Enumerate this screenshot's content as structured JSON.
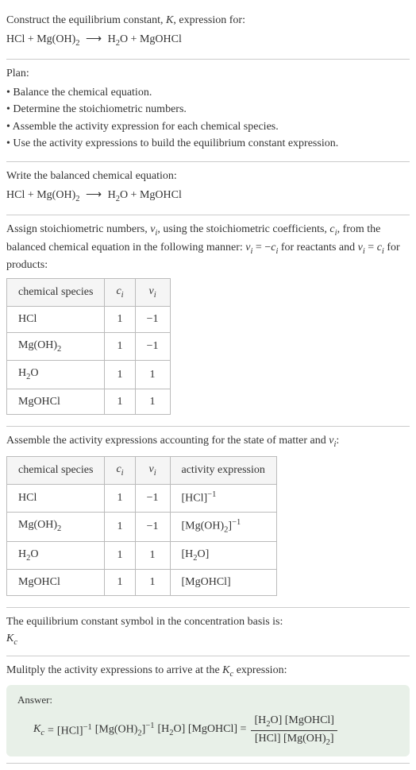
{
  "header": {
    "title_prefix": "Construct the equilibrium constant, ",
    "title_k": "K",
    "title_suffix": ", expression for:",
    "equation_left": "HCl + Mg(OH)",
    "equation_sub1": "2",
    "equation_arrow": "⟶",
    "equation_right1": "H",
    "equation_sub2": "2",
    "equation_right2": "O + MgOHCl"
  },
  "plan": {
    "title": "Plan:",
    "items": [
      "• Balance the chemical equation.",
      "• Determine the stoichiometric numbers.",
      "• Assemble the activity expression for each chemical species.",
      "• Use the activity expressions to build the equilibrium constant expression."
    ]
  },
  "balanced": {
    "title": "Write the balanced chemical equation:",
    "equation_left": "HCl + Mg(OH)",
    "equation_sub1": "2",
    "equation_arrow": "⟶",
    "equation_right1": "H",
    "equation_sub2": "2",
    "equation_right2": "O + MgOHCl"
  },
  "stoich": {
    "text1": "Assign stoichiometric numbers, ",
    "nu": "ν",
    "sub_i": "i",
    "text2": ", using the stoichiometric coefficients, ",
    "c": "c",
    "text3": ", from the balanced chemical equation in the following manner: ",
    "eq1a": "ν",
    "eq1b": " = −",
    "eq1c": "c",
    "text4": " for reactants and ",
    "eq2a": "ν",
    "eq2b": " = ",
    "eq2c": "c",
    "text5": " for products:",
    "headers": {
      "species": "chemical species",
      "ci": "c",
      "ci_sub": "i",
      "vi": "ν",
      "vi_sub": "i"
    },
    "rows": [
      {
        "name": "HCl",
        "sub": "",
        "ci": "1",
        "vi": "−1"
      },
      {
        "name": "Mg(OH)",
        "sub": "2",
        "ci": "1",
        "vi": "−1"
      },
      {
        "name": "H",
        "sub": "2",
        "suffix": "O",
        "ci": "1",
        "vi": "1"
      },
      {
        "name": "MgOHCl",
        "sub": "",
        "ci": "1",
        "vi": "1"
      }
    ]
  },
  "activity": {
    "title_pre": "Assemble the activity expressions accounting for the state of matter and ",
    "title_nu": "ν",
    "title_sub": "i",
    "title_post": ":",
    "headers": {
      "species": "chemical species",
      "ci": "c",
      "ci_sub": "i",
      "vi": "ν",
      "vi_sub": "i",
      "activity": "activity expression"
    },
    "rows": [
      {
        "name": "HCl",
        "sub": "",
        "ci": "1",
        "vi": "−1",
        "expr": "[HCl]",
        "exp": "−1"
      },
      {
        "name": "Mg(OH)",
        "sub": "2",
        "ci": "1",
        "vi": "−1",
        "expr_pre": "[Mg(OH)",
        "expr_sub": "2",
        "expr_post": "]",
        "exp": "−1"
      },
      {
        "name": "H",
        "sub": "2",
        "suffix": "O",
        "ci": "1",
        "vi": "1",
        "expr_pre": "[H",
        "expr_sub": "2",
        "expr_post": "O]",
        "exp": ""
      },
      {
        "name": "MgOHCl",
        "sub": "",
        "ci": "1",
        "vi": "1",
        "expr": "[MgOHCl]",
        "exp": ""
      }
    ]
  },
  "symbol": {
    "text": "The equilibrium constant symbol in the concentration basis is:",
    "kc_k": "K",
    "kc_c": "c"
  },
  "multiply": {
    "text_pre": "Mulitply the activity expressions to arrive at the ",
    "kc_k": "K",
    "kc_c": "c",
    "text_post": " expression:"
  },
  "answer": {
    "label": "Answer:",
    "kc_k": "K",
    "kc_c": "c",
    "eq": " = ",
    "t1": "[HCl]",
    "e1": "−1",
    "t2_pre": " [Mg(OH)",
    "t2_sub": "2",
    "t2_post": "]",
    "e2": "−1",
    "t3_pre": " [H",
    "t3_sub": "2",
    "t3_post": "O] [MgOHCl] = ",
    "num_pre": "[H",
    "num_sub": "2",
    "num_post": "O] [MgOHCl]",
    "den_pre": "[HCl] [Mg(OH)",
    "den_sub": "2",
    "den_post": "]"
  }
}
